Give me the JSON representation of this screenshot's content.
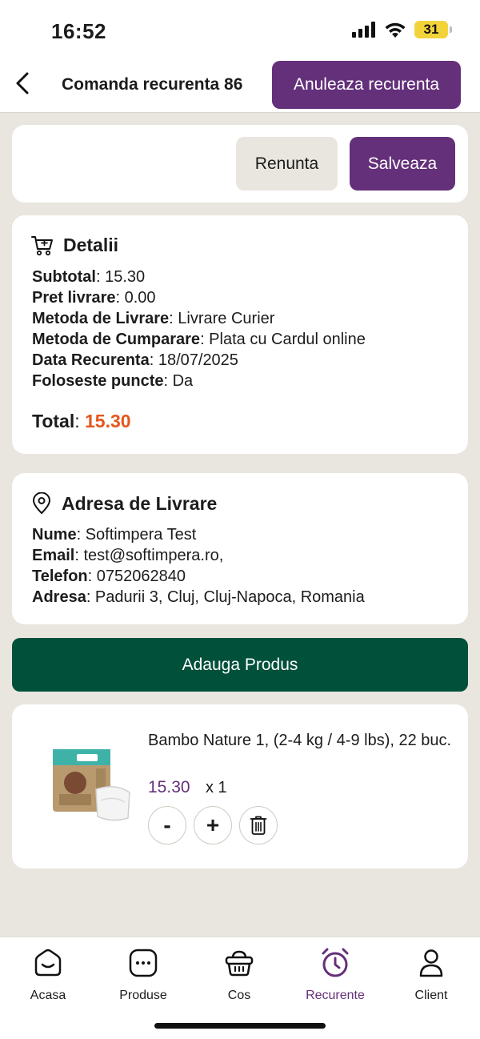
{
  "status": {
    "time": "16:52",
    "battery": "31"
  },
  "header": {
    "title": "Comanda recurenta 86",
    "cancel_recurrence": "Anuleaza recurenta"
  },
  "actions": {
    "cancel": "Renunta",
    "save": "Salveaza"
  },
  "details": {
    "title": "Detalii",
    "rows": [
      {
        "label": "Subtotal",
        "value": ": 15.30"
      },
      {
        "label": "Pret livrare",
        "value": ": 0.00"
      },
      {
        "label": "Metoda de Livrare",
        "value": ": Livrare Curier"
      },
      {
        "label": "Metoda de Cumparare",
        "value": ": Plata cu Cardul online"
      },
      {
        "label": "Data Recurenta",
        "value": ": 18/07/2025"
      },
      {
        "label": "Foloseste puncte",
        "value": ": Da"
      }
    ],
    "total_label": "Total",
    "total_sep": ": ",
    "total_value": "15.30"
  },
  "address": {
    "title": "Adresa de Livrare",
    "rows": [
      {
        "label": "Nume",
        "value": ": Softimpera Test"
      },
      {
        "label": "Email",
        "value": ": test@softimpera.ro,"
      },
      {
        "label": "Telefon",
        "value": ": 0752062840"
      },
      {
        "label": "Adresa",
        "value": ": Padurii 3, Cluj, Cluj-Napoca, Romania"
      }
    ]
  },
  "add_product": "Adauga Produs",
  "product": {
    "name": "Bambo Nature 1, (2-4 kg / 4-9 lbs), 22 buc.",
    "price": "15.30",
    "qty": "x 1",
    "minus": "-",
    "plus": "+"
  },
  "tabs": [
    {
      "label": "Acasa"
    },
    {
      "label": "Produse"
    },
    {
      "label": "Cos"
    },
    {
      "label": "Recurente"
    },
    {
      "label": "Client"
    }
  ],
  "colors": {
    "primary": "#64307a",
    "green": "#00503a",
    "accent": "#e4561c",
    "background": "#e9e6df"
  }
}
